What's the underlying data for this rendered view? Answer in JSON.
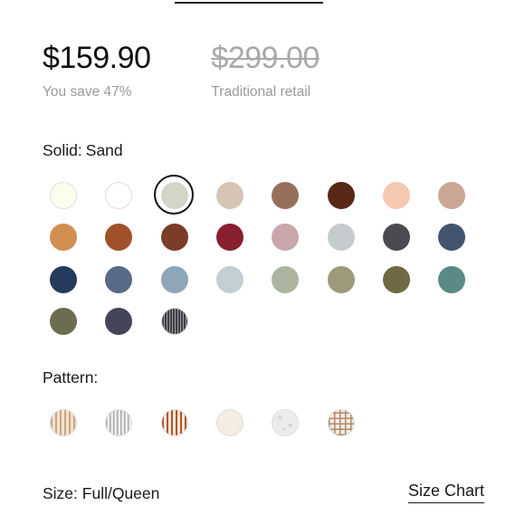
{
  "pricing": {
    "sale_price": "$159.90",
    "savings_text": "You save 47%",
    "retail_price": "$299.00",
    "retail_label": "Traditional retail"
  },
  "solid": {
    "label": "Solid:",
    "selected_value": "Sand",
    "swatches": [
      {
        "color": "#fcfdec"
      },
      {
        "color": "#ffffff"
      },
      {
        "color": "#d3d5c9",
        "selected": true
      },
      {
        "color": "#d6c5b4"
      },
      {
        "color": "#97705d"
      },
      {
        "color": "#572818"
      },
      {
        "color": "#f4c9b0"
      },
      {
        "color": "#c9a794"
      },
      {
        "color": "#d38e52"
      },
      {
        "color": "#a0512a"
      },
      {
        "color": "#7b3c2a"
      },
      {
        "color": "#8a1f2e"
      },
      {
        "color": "#c7a7aa"
      },
      {
        "color": "#c6cccd"
      },
      {
        "color": "#4a4b50"
      },
      {
        "color": "#43546f"
      },
      {
        "color": "#263a5e"
      },
      {
        "color": "#566b85"
      },
      {
        "color": "#8fa6b9"
      },
      {
        "color": "#c3ced4"
      },
      {
        "color": "#adb5a0"
      },
      {
        "color": "#9d9a7b"
      },
      {
        "color": "#6f6946"
      },
      {
        "color": "#5a8a86"
      },
      {
        "color": "#6d6c50"
      },
      {
        "color": "#444558"
      },
      {
        "color": "#55565a",
        "pattern": "pinstripe"
      }
    ]
  },
  "pattern": {
    "label": "Pattern:",
    "swatches": [
      {
        "pattern": "tan-stripe"
      },
      {
        "pattern": "grey-stripe"
      },
      {
        "pattern": "rust-stripe"
      },
      {
        "pattern": "cream"
      },
      {
        "pattern": "speckle"
      },
      {
        "pattern": "plaid"
      }
    ]
  },
  "size": {
    "label": "Size:",
    "selected_value": "Full/Queen",
    "chart_link": "Size Chart"
  }
}
